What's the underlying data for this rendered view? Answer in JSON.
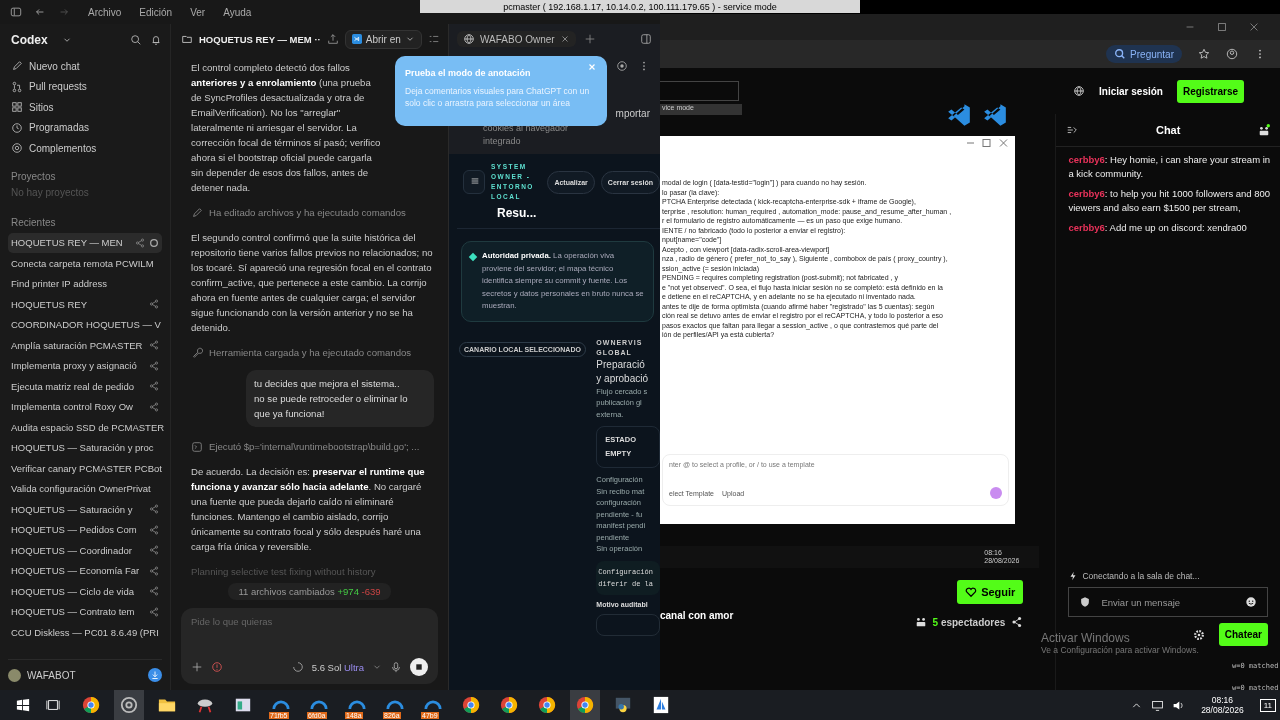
{
  "menu_bar": {
    "items": [
      "Archivo",
      "Edición",
      "Ver",
      "Ayuda"
    ]
  },
  "remote_title": "pcmaster ( 192.168.1.17, 10.14.0.2, 100.111.179.65 ) - service mode",
  "sidebar": {
    "app_name": "Codex",
    "nav": [
      {
        "kind": "new",
        "label": "Nuevo chat"
      },
      {
        "kind": "pull",
        "label": "Pull requests"
      },
      {
        "kind": "sites",
        "label": "Sitios"
      },
      {
        "kind": "clock",
        "label": "Programadas"
      },
      {
        "kind": "plugin",
        "label": "Complementos"
      }
    ],
    "projects_heading": "Proyectos",
    "projects_empty": "No hay proyectos",
    "recents_heading": "Recientes",
    "recents": [
      {
        "title": "HOQUETUS REY — MEN",
        "selected": true,
        "shared": true,
        "running": true
      },
      {
        "title": "Conecta carpeta remota PCWILM",
        "selected": false,
        "shared": false,
        "running": false
      },
      {
        "title": "Find printer IP address",
        "selected": false,
        "shared": false,
        "running": false
      },
      {
        "title": "HOQUETUS REY",
        "selected": false,
        "shared": true,
        "running": false
      },
      {
        "title": "COORDINADOR HOQUETUS — V",
        "selected": false,
        "shared": false,
        "running": false
      },
      {
        "title": "Amplía saturación PCMASTER",
        "selected": false,
        "shared": true,
        "running": false
      },
      {
        "title": "Implementa proxy y asignació",
        "selected": false,
        "shared": true,
        "running": false
      },
      {
        "title": "Ejecuta matriz real de pedido",
        "selected": false,
        "shared": true,
        "running": false
      },
      {
        "title": "Implementa control Roxy Ow",
        "selected": false,
        "shared": true,
        "running": false
      },
      {
        "title": "Audita espacio SSD de PCMASTER",
        "selected": false,
        "shared": false,
        "running": false
      },
      {
        "title": "HOQUETUS — Saturación y proc",
        "selected": false,
        "shared": false,
        "running": false
      },
      {
        "title": "Verificar canary PCMASTER PCBot",
        "selected": false,
        "shared": false,
        "running": false
      },
      {
        "title": "Valida configuración OwnerPrivat",
        "selected": false,
        "shared": false,
        "running": false
      },
      {
        "title": "HOQUETUS — Saturación y",
        "selected": false,
        "shared": true,
        "running": false
      },
      {
        "title": "HOQUETUS — Pedidos Com",
        "selected": false,
        "shared": true,
        "running": false
      },
      {
        "title": "HOQUETUS — Coordinador",
        "selected": false,
        "shared": true,
        "running": false
      },
      {
        "title": "HOQUETUS — Economía Far",
        "selected": false,
        "shared": true,
        "running": false
      },
      {
        "title": "HOQUETUS — Ciclo de vida",
        "selected": false,
        "shared": true,
        "running": false
      },
      {
        "title": "HOQUETUS — Contrato tem",
        "selected": false,
        "shared": true,
        "running": false
      },
      {
        "title": "CCU Diskless — PC01 8.6.49 (PRI",
        "selected": false,
        "shared": false,
        "running": false
      }
    ],
    "user": "WAFABOT"
  },
  "thread": {
    "title": "HOQUETUS REY — MEM ··",
    "open_in": "Abrir en",
    "messages": [
      {
        "kind": "assistant",
        "text": "El control completo detectó dos fallos **anteriores y** **a enrolamiento** (una prueba de SyncProfiles desactualizada y otra de EmailVerification). No los \"arreglar\" lateralmente ni arriesgar el servidor. La corrección focal de términos sí pasó; verifico ahora si el bootstrap oficial puede cargarla sin depender de esos dos fallos, antes de detener nada."
      },
      {
        "kind": "edit",
        "text": "Ha editado archivos y ha ejecutado comandos"
      },
      {
        "kind": "assistant",
        "text": "El segundo control confirmó que la suite histórica del repositorio tiene varios fallos previos no relacionados; no los tocaré. Sí apareció una regresión focal en el contrato confirm_active, que pertenece a este cambio. La corrijo ahora en fuente antes de cualquier carga; el servidor sigue funcionando con la versión anterior y no se ha detenido."
      },
      {
        "kind": "tool",
        "text": "Herramienta cargada y ha ejecutado comandos"
      },
      {
        "kind": "user",
        "text": "tu decides que mejora el sistema..\nno se puede retroceder o eliminar lo que ya funciona!"
      },
      {
        "kind": "command",
        "text": "Ejecutó $p='internal\\runtimebootstrap\\build.go'; ..."
      },
      {
        "kind": "assistant",
        "text": "De acuerdo. La decisión es: **preservar el runtime que funciona y avanzar sólo hacia adelante**. No cargaré una fuente que pueda dejarlo caído ni eliminaré funciones. Mantengo el cambio aislado, corrijo únicamente su contrato focal y sólo después haré una carga fría única y reversible."
      },
      {
        "kind": "thinking",
        "text": "Planning selective test fixing without history"
      }
    ],
    "changes": {
      "label": "11 archivos cambiados",
      "added": "+974",
      "removed": "-639"
    },
    "composer": {
      "placeholder": "Pide lo que quieras",
      "model": "5.6 Sol",
      "effort": "Ultra"
    }
  },
  "annotation_popup": {
    "title": "Prueba el modo de anotación",
    "body": "Deja comentarios visuales para ChatGPT con un solo clic o arrastra para seleccionar un área"
  },
  "browser_panel": {
    "tab": "WAFABO Owner",
    "import_button": "mportar",
    "cookies_text": "cookies al navegador integrado",
    "section_label": "SYSTEM OWNER - ENTORNO LOCAL",
    "heading": "Resu...",
    "buttons": [
      "Actualizar",
      "Cerrar sesión"
    ],
    "notice": "**Autoridad privada.** La operación viva proviene del servidor; el mapa técnico identifica siempre su commit y fuente. Los secretos y datos personales en bruto nunca se muestran.",
    "badge": "CANARIO LOCAL SELECCIONADO",
    "kicker": "OWNERVIS GLOBAL",
    "title_lines": [
      "Preparació",
      "y aprobació"
    ],
    "desc_lines": [
      "Flujo cercado s",
      "publicación gl",
      "externa."
    ],
    "state_label": "ESTADO",
    "state_value": "EMPTY",
    "config_heading": "Configuración",
    "config_lines": [
      "Sin recibo mat",
      "configuración",
      "pendiente - fu",
      "manifest pendi",
      "pendiente"
    ],
    "op_line": "Sin operación",
    "code_lines": [
      "Configuración",
      "diferir de la"
    ],
    "motive_label": "Motivo auditabl"
  },
  "kick": {
    "ask_button": "Preguntar",
    "login": "Iniciar sesión",
    "register": "Registrarse",
    "remote_window_title": "vice mode",
    "document_lines": [
      "modal de login ( [data-testid=\"login\"] ) para cuando no hay sesión.",
      "lo pasar (la clave):",
      "PTCHA Enterprise detectada ( kick-recaptcha-enterprise-sdk + iframe de Google),",
      "terprise , resolution: human_required , automation_mode: pause_and_resume_after_human ,",
      "r el formulario de registro automáticamente — es un paso que exige humano.",
      "IENTE / no fabricado (todo lo posterior a enviar el registro):",
      "nput[name=\"code\"]",
      "Acepto , con viewport [data-radix-scroll-area-viewport]",
      "nza , radio de género ( prefer_not_to_say ), Siguiente , combobox de país ( proxy_country ),",
      "ssion_active (= sesión iniciada)",
      "PENDING = requires completing registration (post-submit); not fabricated , y",
      "e \"not yet observed\". O sea, el flujo hasta iniciar sesión no se completó: está definido en la",
      "e detiene en el reCAPTCHA, y en adelante no se ha ejecutado ni inventado nada.",
      "antes te dije de forma optimista (cuando afirmé haber \"registrado\" las 5 cuentas): según",
      "ción real se detuvo antes de enviar el registro por el reCAPTCHA, y todo lo posterior a eso",
      "pasos exactos que faltan para llegar a session_active , o que contrastemos qué parte del",
      "ión de perfiles/API ya está cubierta?"
    ],
    "doc_composer_placeholder": "nter @ to select a profile, or / to use a template",
    "doc_buttons": [
      "elect Template",
      "Upload"
    ],
    "remote_time": "08:16",
    "remote_date": "28/08/2026",
    "follow": "Seguir",
    "channel_text": "canal con amor",
    "viewers_count": "5",
    "viewers_label": "espectadores",
    "chat_title": "Chat",
    "chat_messages": [
      {
        "user": "cerbby6",
        "text": ": Hey homie, i can share your stream in a kick community.",
        "color": "#e8325a"
      },
      {
        "user": "cerbby6",
        "text": ": to help you hit 1000 followers and 800 viewers and also earn $1500 per stream,",
        "color": "#e8325a"
      },
      {
        "user": "cerbby6",
        "text": ": Add me up on discord: xendra00",
        "color": "#e8325a"
      }
    ],
    "connecting": "Conectando a la sala de chat...",
    "message_placeholder": "Enviar un mensaje",
    "send_button": "Chatear"
  },
  "activation": {
    "title": "Activar Windows",
    "body": "Ve a Configuración para activar Windows."
  },
  "terminal_lines": [
    "w=0 matched",
    "w=0 matched"
  ],
  "taskbar": {
    "items": [
      {
        "kind": "chrome",
        "selected": false
      },
      {
        "kind": "codex",
        "selected": true
      },
      {
        "kind": "folder",
        "selected": false
      },
      {
        "kind": "tool",
        "selected": false
      },
      {
        "kind": "window",
        "selected": false
      },
      {
        "kind": "remote",
        "label": "71fb5",
        "selected": false
      },
      {
        "kind": "remote",
        "label": "6fd0a",
        "selected": false
      },
      {
        "kind": "remote",
        "label": "148a",
        "selected": false
      },
      {
        "kind": "remote",
        "label": "826a",
        "selected": false
      },
      {
        "kind": "remote",
        "label": "47b9",
        "selected": false
      },
      {
        "kind": "chrome",
        "selected": false
      },
      {
        "kind": "chrome",
        "selected": false
      },
      {
        "kind": "chrome",
        "selected": false
      },
      {
        "kind": "chrome",
        "selected": true
      },
      {
        "kind": "python",
        "selected": false
      },
      {
        "kind": "sail",
        "selected": false
      }
    ],
    "time": "08:16",
    "date": "28/08/2026",
    "notifications": "11"
  }
}
